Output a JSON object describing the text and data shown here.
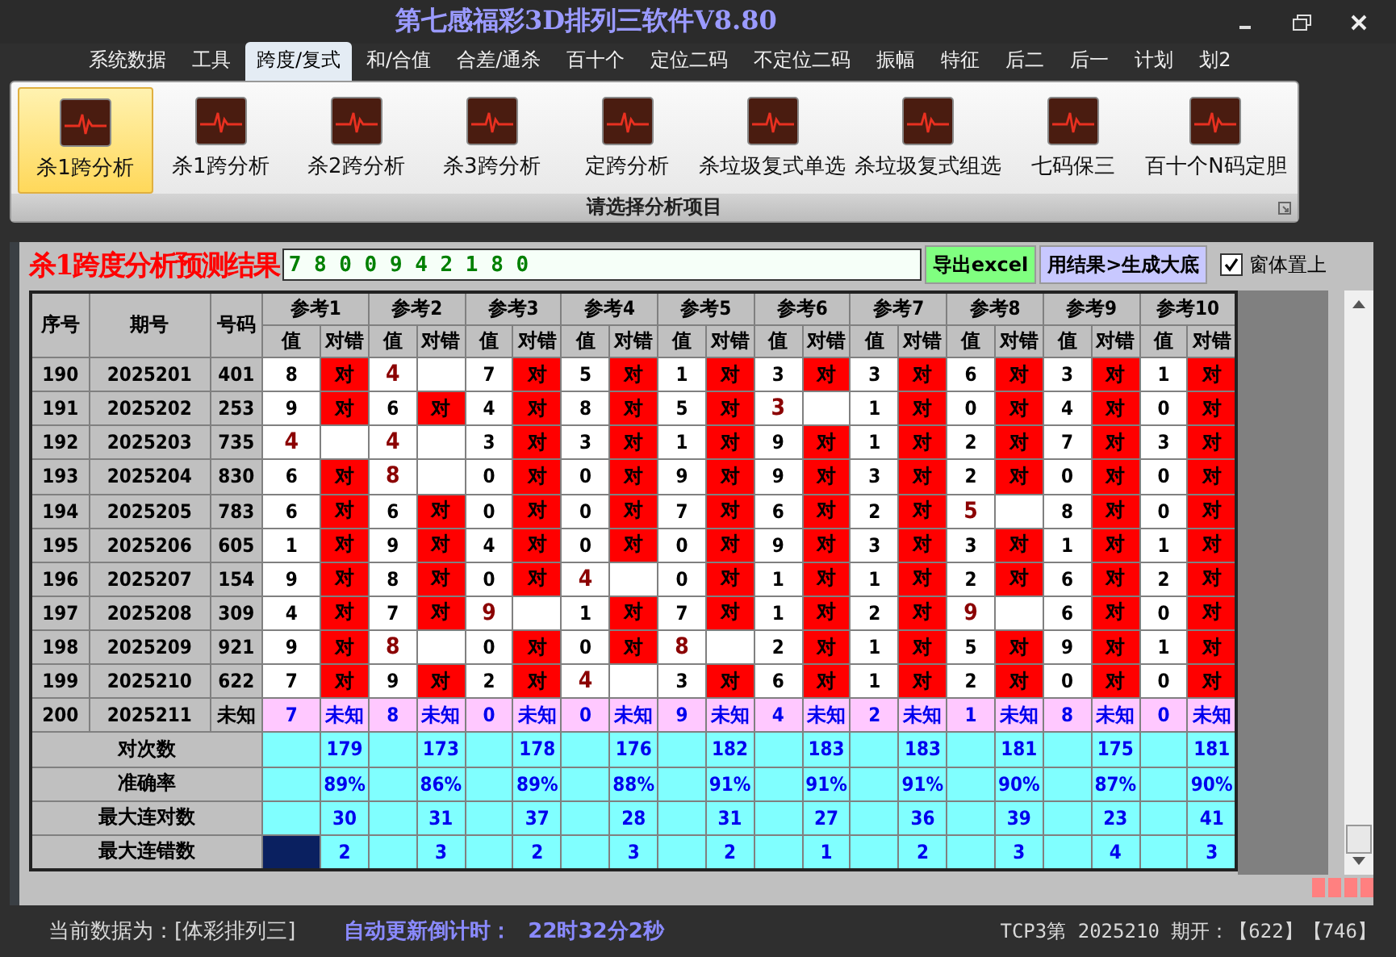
{
  "window": {
    "title": "第七感福彩3D排列三软件V8.80"
  },
  "menu": [
    {
      "label": "系统数据",
      "selected": false
    },
    {
      "label": "工具",
      "selected": false
    },
    {
      "label": "跨度/复式",
      "selected": true
    },
    {
      "label": "和/合值",
      "selected": false
    },
    {
      "label": "合差/通杀",
      "selected": false
    },
    {
      "label": "百十个",
      "selected": false
    },
    {
      "label": "定位二码",
      "selected": false
    },
    {
      "label": "不定位二码",
      "selected": false
    },
    {
      "label": "振幅",
      "selected": false
    },
    {
      "label": "特征",
      "selected": false
    },
    {
      "label": "后二",
      "selected": false
    },
    {
      "label": "后一",
      "selected": false
    },
    {
      "label": "计划",
      "selected": false
    },
    {
      "label": "划2",
      "selected": false
    }
  ],
  "ribbon": {
    "items": [
      {
        "label": "杀1跨分析",
        "selected": true
      },
      {
        "label": "杀1跨分析",
        "selected": false
      },
      {
        "label": "杀2跨分析",
        "selected": false
      },
      {
        "label": "杀3跨分析",
        "selected": false
      },
      {
        "label": "定跨分析",
        "selected": false
      },
      {
        "label": "杀垃圾复式单选",
        "selected": false
      },
      {
        "label": "杀垃圾复式组选",
        "selected": false
      },
      {
        "label": "七码保三",
        "selected": false
      },
      {
        "label": "百十个N码定胆",
        "selected": false
      }
    ],
    "group_label": "请选择分析项目"
  },
  "result": {
    "title": "杀1跨度分析预测结果",
    "value": "7 8 0 0 9 4 2 1 8 0"
  },
  "buttons": [
    {
      "label": "导出excel",
      "kind": "export"
    },
    {
      "label": "用结果>生成大底",
      "kind": "generate"
    }
  ],
  "stay_on_top": {
    "label": "窗体置上",
    "checked": true
  },
  "table": {
    "columns": [
      "序号",
      "期号",
      "号码"
    ],
    "ref_groups": [
      {
        "label": "参考1",
        "sub_columns": [
          "值",
          "对错"
        ]
      },
      {
        "label": "参考2",
        "sub_columns": [
          "值",
          "对错"
        ]
      },
      {
        "label": "参考3",
        "sub_columns": [
          "值",
          "对错"
        ]
      },
      {
        "label": "参考4",
        "sub_columns": [
          "值",
          "对错"
        ]
      },
      {
        "label": "参考5",
        "sub_columns": [
          "值",
          "对错"
        ]
      },
      {
        "label": "参考6",
        "sub_columns": [
          "值",
          "对错"
        ]
      },
      {
        "label": "参考7",
        "sub_columns": [
          "值",
          "对错"
        ]
      },
      {
        "label": "参考8",
        "sub_columns": [
          "值",
          "对错"
        ]
      },
      {
        "label": "参考9",
        "sub_columns": [
          "值",
          "对错"
        ]
      },
      {
        "label": "参考10",
        "sub_columns": [
          "值",
          "对错"
        ]
      }
    ],
    "rows": [
      {
        "kind": "result",
        "seq": "190",
        "period": "2025201",
        "number": "401",
        "refs": [
          {
            "value": "8",
            "hit": true,
            "mark": "对"
          },
          {
            "value": "4",
            "hit": false
          },
          {
            "value": "7",
            "hit": true,
            "mark": "对"
          },
          {
            "value": "5",
            "hit": true,
            "mark": "对"
          },
          {
            "value": "1",
            "hit": true,
            "mark": "对"
          },
          {
            "value": "3",
            "hit": true,
            "mark": "对"
          },
          {
            "value": "3",
            "hit": true,
            "mark": "对"
          },
          {
            "value": "6",
            "hit": true,
            "mark": "对"
          },
          {
            "value": "3",
            "hit": true,
            "mark": "对"
          },
          {
            "value": "1",
            "hit": true,
            "mark": "对"
          }
        ]
      },
      {
        "kind": "result",
        "seq": "191",
        "period": "2025202",
        "number": "253",
        "refs": [
          {
            "value": "9",
            "hit": true,
            "mark": "对"
          },
          {
            "value": "6",
            "hit": true,
            "mark": "对"
          },
          {
            "value": "4",
            "hit": true,
            "mark": "对"
          },
          {
            "value": "8",
            "hit": true,
            "mark": "对"
          },
          {
            "value": "5",
            "hit": true,
            "mark": "对"
          },
          {
            "value": "3",
            "hit": false
          },
          {
            "value": "1",
            "hit": true,
            "mark": "对"
          },
          {
            "value": "0",
            "hit": true,
            "mark": "对"
          },
          {
            "value": "4",
            "hit": true,
            "mark": "对"
          },
          {
            "value": "0",
            "hit": true,
            "mark": "对"
          }
        ]
      },
      {
        "kind": "result",
        "seq": "192",
        "period": "2025203",
        "number": "735",
        "refs": [
          {
            "value": "4",
            "hit": false
          },
          {
            "value": "4",
            "hit": false
          },
          {
            "value": "3",
            "hit": true,
            "mark": "对"
          },
          {
            "value": "3",
            "hit": true,
            "mark": "对"
          },
          {
            "value": "1",
            "hit": true,
            "mark": "对"
          },
          {
            "value": "9",
            "hit": true,
            "mark": "对"
          },
          {
            "value": "1",
            "hit": true,
            "mark": "对"
          },
          {
            "value": "2",
            "hit": true,
            "mark": "对"
          },
          {
            "value": "7",
            "hit": true,
            "mark": "对"
          },
          {
            "value": "3",
            "hit": true,
            "mark": "对"
          }
        ]
      },
      {
        "kind": "result",
        "seq": "193",
        "period": "2025204",
        "number": "830",
        "refs": [
          {
            "value": "6",
            "hit": true,
            "mark": "对"
          },
          {
            "value": "8",
            "hit": false
          },
          {
            "value": "0",
            "hit": true,
            "mark": "对"
          },
          {
            "value": "0",
            "hit": true,
            "mark": "对"
          },
          {
            "value": "9",
            "hit": true,
            "mark": "对"
          },
          {
            "value": "9",
            "hit": true,
            "mark": "对"
          },
          {
            "value": "3",
            "hit": true,
            "mark": "对"
          },
          {
            "value": "2",
            "hit": true,
            "mark": "对"
          },
          {
            "value": "0",
            "hit": true,
            "mark": "对"
          },
          {
            "value": "0",
            "hit": true,
            "mark": "对"
          }
        ]
      },
      {
        "kind": "result",
        "seq": "194",
        "period": "2025205",
        "number": "783",
        "refs": [
          {
            "value": "6",
            "hit": true,
            "mark": "对"
          },
          {
            "value": "6",
            "hit": true,
            "mark": "对"
          },
          {
            "value": "0",
            "hit": true,
            "mark": "对"
          },
          {
            "value": "0",
            "hit": true,
            "mark": "对"
          },
          {
            "value": "7",
            "hit": true,
            "mark": "对"
          },
          {
            "value": "6",
            "hit": true,
            "mark": "对"
          },
          {
            "value": "2",
            "hit": true,
            "mark": "对"
          },
          {
            "value": "5",
            "hit": false
          },
          {
            "value": "8",
            "hit": true,
            "mark": "对"
          },
          {
            "value": "0",
            "hit": true,
            "mark": "对"
          }
        ]
      },
      {
        "kind": "result",
        "seq": "195",
        "period": "2025206",
        "number": "605",
        "refs": [
          {
            "value": "1",
            "hit": true,
            "mark": "对"
          },
          {
            "value": "9",
            "hit": true,
            "mark": "对"
          },
          {
            "value": "4",
            "hit": true,
            "mark": "对"
          },
          {
            "value": "0",
            "hit": true,
            "mark": "对"
          },
          {
            "value": "0",
            "hit": true,
            "mark": "对"
          },
          {
            "value": "9",
            "hit": true,
            "mark": "对"
          },
          {
            "value": "3",
            "hit": true,
            "mark": "对"
          },
          {
            "value": "3",
            "hit": true,
            "mark": "对"
          },
          {
            "value": "1",
            "hit": true,
            "mark": "对"
          },
          {
            "value": "1",
            "hit": true,
            "mark": "对"
          }
        ]
      },
      {
        "kind": "result",
        "seq": "196",
        "period": "2025207",
        "number": "154",
        "refs": [
          {
            "value": "9",
            "hit": true,
            "mark": "对"
          },
          {
            "value": "8",
            "hit": true,
            "mark": "对"
          },
          {
            "value": "0",
            "hit": true,
            "mark": "对"
          },
          {
            "value": "4",
            "hit": false
          },
          {
            "value": "0",
            "hit": true,
            "mark": "对"
          },
          {
            "value": "1",
            "hit": true,
            "mark": "对"
          },
          {
            "value": "1",
            "hit": true,
            "mark": "对"
          },
          {
            "value": "2",
            "hit": true,
            "mark": "对"
          },
          {
            "value": "6",
            "hit": true,
            "mark": "对"
          },
          {
            "value": "2",
            "hit": true,
            "mark": "对"
          }
        ]
      },
      {
        "kind": "result",
        "seq": "197",
        "period": "2025208",
        "number": "309",
        "refs": [
          {
            "value": "4",
            "hit": true,
            "mark": "对"
          },
          {
            "value": "7",
            "hit": true,
            "mark": "对"
          },
          {
            "value": "9",
            "hit": false
          },
          {
            "value": "1",
            "hit": true,
            "mark": "对"
          },
          {
            "value": "7",
            "hit": true,
            "mark": "对"
          },
          {
            "value": "1",
            "hit": true,
            "mark": "对"
          },
          {
            "value": "2",
            "hit": true,
            "mark": "对"
          },
          {
            "value": "9",
            "hit": false
          },
          {
            "value": "6",
            "hit": true,
            "mark": "对"
          },
          {
            "value": "0",
            "hit": true,
            "mark": "对"
          }
        ]
      },
      {
        "kind": "result",
        "seq": "198",
        "period": "2025209",
        "number": "921",
        "refs": [
          {
            "value": "9",
            "hit": true,
            "mark": "对"
          },
          {
            "value": "8",
            "hit": false
          },
          {
            "value": "0",
            "hit": true,
            "mark": "对"
          },
          {
            "value": "0",
            "hit": true,
            "mark": "对"
          },
          {
            "value": "8",
            "hit": false
          },
          {
            "value": "2",
            "hit": true,
            "mark": "对"
          },
          {
            "value": "1",
            "hit": true,
            "mark": "对"
          },
          {
            "value": "5",
            "hit": true,
            "mark": "对"
          },
          {
            "value": "9",
            "hit": true,
            "mark": "对"
          },
          {
            "value": "1",
            "hit": true,
            "mark": "对"
          }
        ]
      },
      {
        "kind": "result",
        "seq": "199",
        "period": "2025210",
        "number": "622",
        "refs": [
          {
            "value": "7",
            "hit": true,
            "mark": "对"
          },
          {
            "value": "9",
            "hit": true,
            "mark": "对"
          },
          {
            "value": "2",
            "hit": true,
            "mark": "对"
          },
          {
            "value": "4",
            "hit": false
          },
          {
            "value": "3",
            "hit": true,
            "mark": "对"
          },
          {
            "value": "6",
            "hit": true,
            "mark": "对"
          },
          {
            "value": "1",
            "hit": true,
            "mark": "对"
          },
          {
            "value": "2",
            "hit": true,
            "mark": "对"
          },
          {
            "value": "0",
            "hit": true,
            "mark": "对"
          },
          {
            "value": "0",
            "hit": true,
            "mark": "对"
          }
        ]
      },
      {
        "kind": "pending",
        "seq": "200",
        "period": "2025211",
        "number": "未知",
        "refs": [
          {
            "value": "7",
            "mark": "未知"
          },
          {
            "value": "8",
            "mark": "未知"
          },
          {
            "value": "0",
            "mark": "未知"
          },
          {
            "value": "0",
            "mark": "未知"
          },
          {
            "value": "9",
            "mark": "未知"
          },
          {
            "value": "4",
            "mark": "未知"
          },
          {
            "value": "2",
            "mark": "未知"
          },
          {
            "value": "1",
            "mark": "未知"
          },
          {
            "value": "8",
            "mark": "未知"
          },
          {
            "value": "0",
            "mark": "未知"
          }
        ]
      }
    ],
    "summary": [
      {
        "label": "对次数",
        "values": [
          "179",
          "173",
          "178",
          "176",
          "182",
          "183",
          "183",
          "181",
          "175",
          "181"
        ]
      },
      {
        "label": "准确率",
        "values": [
          "89%",
          "86%",
          "89%",
          "88%",
          "91%",
          "91%",
          "91%",
          "90%",
          "87%",
          "90%"
        ]
      },
      {
        "label": "最大连对数",
        "values": [
          "30",
          "31",
          "37",
          "28",
          "31",
          "27",
          "36",
          "39",
          "23",
          "41"
        ]
      },
      {
        "label": "最大连错数",
        "values": [
          "2",
          "3",
          "2",
          "3",
          "2",
          "1",
          "2",
          "3",
          "4",
          "3"
        ]
      }
    ]
  },
  "status_bar": {
    "data_source": "当前数据为：[体彩排列三]",
    "countdown_label": "自动更新倒计时：",
    "countdown": "22时32分2秒",
    "draw_info": "TCP3第 2025210 期开：【622】【746】"
  }
}
